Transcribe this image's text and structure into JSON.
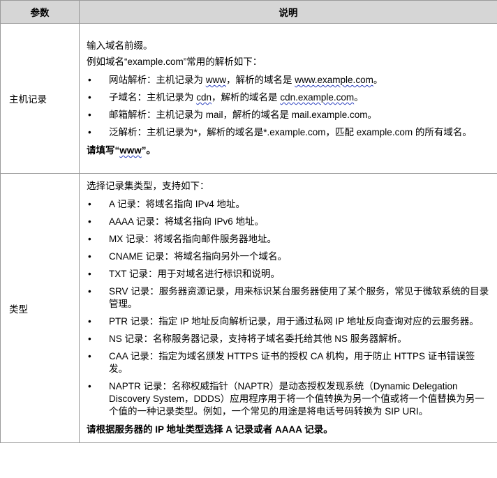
{
  "header": {
    "param": "参数",
    "desc": "说明"
  },
  "row1": {
    "param": "主机记录",
    "intro1": "输入域名前缀。",
    "intro2": "例如域名“example.com”常用的解析如下：",
    "items": [
      [
        "网站解析：主机记录为 ",
        "www",
        "，解析的域名是 ",
        "www.example.com",
        "。"
      ],
      [
        "子域名：主机记录为 ",
        "cdn",
        "，解析的域名是 ",
        "cdn.example.com",
        "。"
      ],
      [
        "邮箱解析：主机记录为 mail，解析的域名是 mail.example.com。"
      ],
      [
        "泛解析：主机记录为*，解析的域名是*.example.com，匹配 example.com 的所有域名。"
      ]
    ],
    "note_pre": "请填写“",
    "note_www": "www",
    "note_post": "”。"
  },
  "row2": {
    "param": "类型",
    "intro": "选择记录集类型，支持如下：",
    "items": [
      "A 记录：将域名指向 IPv4 地址。",
      "AAAA 记录：将域名指向 IPv6 地址。",
      "MX 记录：将域名指向邮件服务器地址。",
      "CNAME 记录：将域名指向另外一个域名。",
      "TXT 记录：用于对域名进行标识和说明。",
      "SRV 记录：服务器资源记录，用来标识某台服务器使用了某个服务，常见于微软系统的目录管理。",
      "PTR 记录：指定 IP 地址反向解析记录，用于通过私网 IP 地址反向查询对应的云服务器。",
      "NS 记录：名称服务器记录，支持将子域名委托给其他 NS 服务器解析。",
      "CAA 记录：指定为域名颁发 HTTPS 证书的授权 CA 机构，用于防止 HTTPS 证书错误签发。",
      "NAPTR 记录：名称权威指针（NAPTR）是动态授权发现系统（Dynamic Delegation Discovery System，DDDS）应用程序用于将一个值转换为另一个值或将一个值替换为另一个值的一种记录类型。例如，一个常见的用途是将电话号码转换为 SIP URI。"
    ],
    "note": "请根据服务器的 IP 地址类型选择 A 记录或者 AAAA 记录。"
  },
  "bullet": "•"
}
